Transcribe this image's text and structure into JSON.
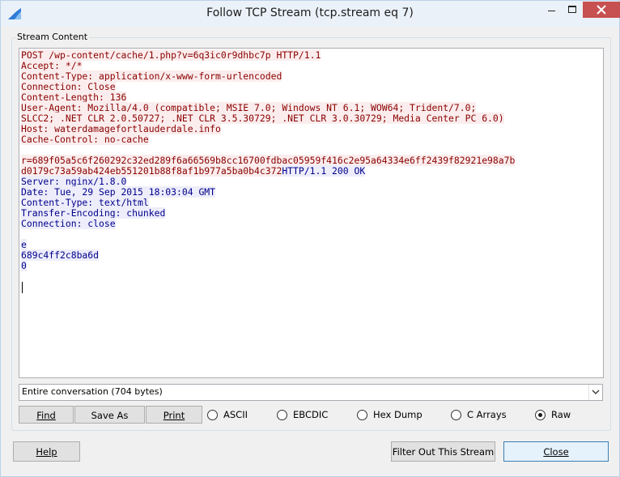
{
  "window": {
    "title": "Follow TCP Stream (tcp.stream eq 7)",
    "icon": "shark-fin-icon"
  },
  "stream_group": {
    "label": "Stream Content",
    "lines": [
      {
        "text": "POST /wp-content/cache/1.php?v=6q3ic0r9dhbc7p HTTP/1.1",
        "side": "client"
      },
      {
        "text": "Accept: */*",
        "side": "client"
      },
      {
        "text": "Content-Type: application/x-www-form-urlencoded",
        "side": "client"
      },
      {
        "text": "Connection: Close",
        "side": "client"
      },
      {
        "text": "Content-Length: 136",
        "side": "client"
      },
      {
        "text": "User-Agent: Mozilla/4.0 (compatible; MSIE 7.0; Windows NT 6.1; WOW64; Trident/7.0;",
        "side": "client"
      },
      {
        "text": "SLCC2; .NET CLR 2.0.50727; .NET CLR 3.5.30729; .NET CLR 3.0.30729; Media Center PC 6.0)",
        "side": "client"
      },
      {
        "text": "Host: waterdamagefortlauderdale.info",
        "side": "client"
      },
      {
        "text": "Cache-Control: no-cache",
        "side": "client"
      },
      {
        "text": "",
        "side": "client"
      },
      {
        "text": "r=689f05a5c6f260292c32ed289f6a66569b8cc16700fdbac05959f416c2e95a64334e6ff2439f82921e98a7b",
        "side": "client"
      },
      {
        "text": "d0179c73a59ab424eb551201b88f8af1b977a5ba0b4c372",
        "side": "client",
        "append": {
          "text": "HTTP/1.1 200 OK",
          "side": "server"
        }
      },
      {
        "text": "Server: nginx/1.8.0",
        "side": "server"
      },
      {
        "text": "Date: Tue, 29 Sep 2015 18:03:04 GMT",
        "side": "server"
      },
      {
        "text": "Content-Type: text/html",
        "side": "server"
      },
      {
        "text": "Transfer-Encoding: chunked",
        "side": "server"
      },
      {
        "text": "Connection: close",
        "side": "server"
      },
      {
        "text": "",
        "side": "server"
      },
      {
        "text": "e",
        "side": "server"
      },
      {
        "text": "689c4ff2c8ba6d",
        "side": "server"
      },
      {
        "text": "0",
        "side": "server"
      }
    ]
  },
  "conversation_select": {
    "value": "Entire conversation (704 bytes)"
  },
  "buttons": {
    "find": "Find",
    "save_as": "Save As",
    "print": "Print",
    "help": "Help",
    "filter_out": "Filter Out This Stream",
    "close": "Close"
  },
  "formats": [
    {
      "label": "ASCII",
      "checked": false
    },
    {
      "label": "EBCDIC",
      "checked": false
    },
    {
      "label": "Hex Dump",
      "checked": false
    },
    {
      "label": "C Arrays",
      "checked": false
    },
    {
      "label": "Raw",
      "checked": true
    }
  ],
  "colors": {
    "client_text": "#8a0000",
    "client_bg": "#fbeded",
    "server_text": "#00008b",
    "server_bg": "#ededfb",
    "close_button": "#c75050"
  }
}
